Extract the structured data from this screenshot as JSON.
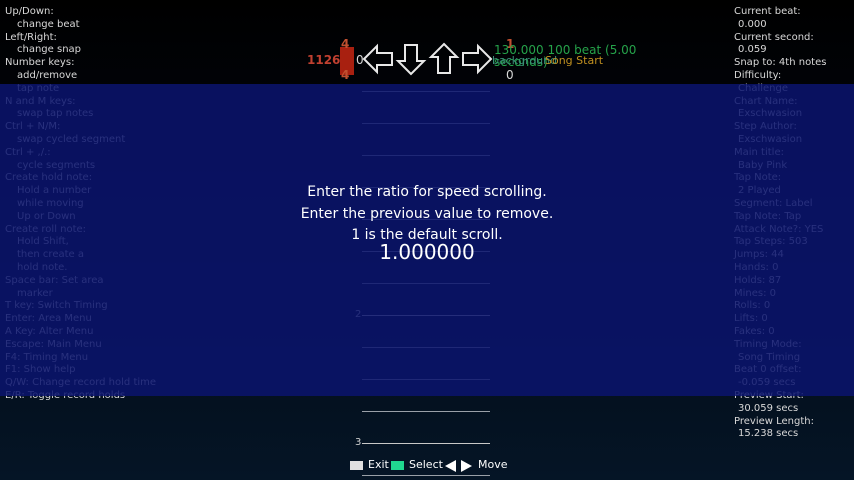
{
  "help_left": [
    {
      "text": "Up/Down:",
      "indent": false
    },
    {
      "text": "change beat",
      "indent": true
    },
    {
      "text": "Left/Right:",
      "indent": false
    },
    {
      "text": "change snap",
      "indent": true
    },
    {
      "text": "Number keys:",
      "indent": false
    },
    {
      "text": "add/remove",
      "indent": true
    },
    {
      "text": "tap note",
      "indent": true
    },
    {
      "text": "N and M keys:",
      "indent": false
    },
    {
      "text": "swap tap notes",
      "indent": true
    },
    {
      "text": "Ctrl + N/M:",
      "indent": false
    },
    {
      "text": "swap cycled segment",
      "indent": true
    },
    {
      "text": "Ctrl + ,/.:",
      "indent": false
    },
    {
      "text": "cycle segments",
      "indent": true
    },
    {
      "text": "Create hold note:",
      "indent": false
    },
    {
      "text": "Hold a number",
      "indent": true
    },
    {
      "text": "while moving",
      "indent": true
    },
    {
      "text": "Up or Down",
      "indent": true
    },
    {
      "text": "Create roll note:",
      "indent": false
    },
    {
      "text": "Hold Shift,",
      "indent": true
    },
    {
      "text": "then create a",
      "indent": true
    },
    {
      "text": "hold note.",
      "indent": true
    },
    {
      "text": "Space bar: Set area",
      "indent": false
    },
    {
      "text": "marker",
      "indent": true
    },
    {
      "text": "T key: Switch Timing",
      "indent": false
    },
    {
      "text": "Enter: Area Menu",
      "indent": false
    },
    {
      "text": "A Key: Alter Menu",
      "indent": false
    },
    {
      "text": "Escape: Main Menu",
      "indent": false
    },
    {
      "text": "F4: Timing Menu",
      "indent": false
    },
    {
      "text": "F1: Show help",
      "indent": false
    },
    {
      "text": "Q/W: Change record hold time",
      "indent": false
    },
    {
      "text": "E/R: Toggle record holds",
      "indent": false
    }
  ],
  "help_right": [
    {
      "text": "Current beat:",
      "indent": false
    },
    {
      "text": "0.000",
      "indent": true
    },
    {
      "text": "Current second:",
      "indent": false
    },
    {
      "text": "0.059",
      "indent": true
    },
    {
      "text": "Snap to: 4th notes",
      "indent": false
    },
    {
      "text": "Difficulty:",
      "indent": false
    },
    {
      "text": "Challenge",
      "indent": true
    },
    {
      "text": "Chart Name:",
      "indent": false
    },
    {
      "text": "Exschwasion",
      "indent": true
    },
    {
      "text": "Step Author:",
      "indent": false
    },
    {
      "text": "Exschwasion",
      "indent": true
    },
    {
      "text": "Main title:",
      "indent": false
    },
    {
      "text": "Baby Pink",
      "indent": true
    },
    {
      "text": "Tap Note:",
      "indent": false
    },
    {
      "text": "2 Played",
      "indent": true
    },
    {
      "text": "Segment: Label",
      "indent": false
    },
    {
      "text": "Tap Note: Tap",
      "indent": false
    },
    {
      "text": "Attack Note?: YES",
      "indent": false
    },
    {
      "text": "Tap Steps: 503",
      "indent": false
    },
    {
      "text": "Jumps: 44",
      "indent": false
    },
    {
      "text": "Hands: 0",
      "indent": false
    },
    {
      "text": "Holds: 87",
      "indent": false
    },
    {
      "text": "Mines: 0",
      "indent": false
    },
    {
      "text": "Rolls: 0",
      "indent": false
    },
    {
      "text": "Lifts: 0",
      "indent": false
    },
    {
      "text": "Fakes: 0",
      "indent": false
    },
    {
      "text": "Timing Mode:",
      "indent": false
    },
    {
      "text": "Song Timing",
      "indent": true
    },
    {
      "text": "Beat 0 offset:",
      "indent": false
    },
    {
      "text": "-0.059 secs",
      "indent": true
    },
    {
      "text": "Preview Start:",
      "indent": false
    },
    {
      "text": "30.059 secs",
      "indent": true
    },
    {
      "text": "Preview Length:",
      "indent": false
    },
    {
      "text": "15.238 secs",
      "indent": true
    }
  ],
  "top_bar": {
    "combo_left": "1126",
    "zero_left": "0",
    "life_top": "4",
    "life_bottom": "4",
    "bpm_text": "130.000 100 beat (5.00 seconds)",
    "bg_change": "background",
    "song_start": "Song Start",
    "right_top": "1",
    "right_bottom": "0"
  },
  "measure_numbers": [
    "2",
    "3"
  ],
  "dialog": {
    "line1": "Enter the ratio for speed scrolling.",
    "line2": "Enter the previous value to remove.",
    "line3": "1 is the default scroll.",
    "value": "1.000000"
  },
  "footer": {
    "exit": "Exit",
    "select": "Select",
    "move": "Move"
  },
  "colors": {
    "overlay": "#0a146e",
    "life_bar": "#a82010",
    "bpm": "#25a34a",
    "select_square": "#20d890"
  }
}
